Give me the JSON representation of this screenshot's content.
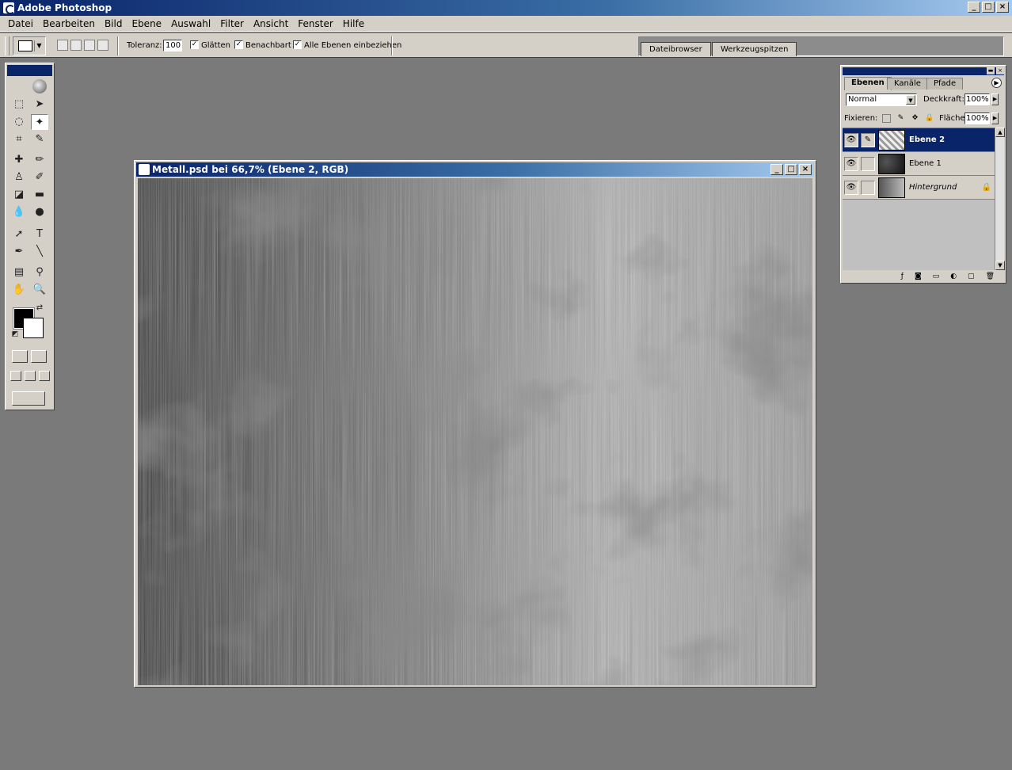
{
  "app": {
    "title": "Adobe Photoshop"
  },
  "menu": [
    "Datei",
    "Bearbeiten",
    "Bild",
    "Ebene",
    "Auswahl",
    "Filter",
    "Ansicht",
    "Fenster",
    "Hilfe"
  ],
  "options": {
    "tolerance_label": "Toleranz:",
    "tolerance_value": "100",
    "antialias_label": "Glätten",
    "antialias_checked": "✓",
    "contiguous_label": "Benachbart",
    "contiguous_checked": "✓",
    "all_layers_label": "Alle Ebenen einbeziehen",
    "all_layers_checked": "✓"
  },
  "palette_well": {
    "tabs": [
      "Dateibrowser",
      "Werkzeugspitzen"
    ]
  },
  "document": {
    "title": "Metall.psd bei 66,7% (Ebene 2, RGB)"
  },
  "layers_palette": {
    "tabs": [
      "Ebenen",
      "Kanäle",
      "Pfade"
    ],
    "blend_mode": "Normal",
    "opacity_label": "Deckkraft:",
    "opacity_value": "100%",
    "lock_label": "Fixieren:",
    "fill_label": "Fläche:",
    "fill_value": "100%",
    "layers": [
      {
        "name": "Ebene 2",
        "selected": true
      },
      {
        "name": "Ebene 1",
        "selected": false
      },
      {
        "name": "Hintergrund",
        "selected": false,
        "locked": true
      }
    ]
  },
  "colors": {
    "foreground": "#000000",
    "background": "#ffffff",
    "titlebar": "#0a246a",
    "workspace": "#7a7a7a"
  }
}
